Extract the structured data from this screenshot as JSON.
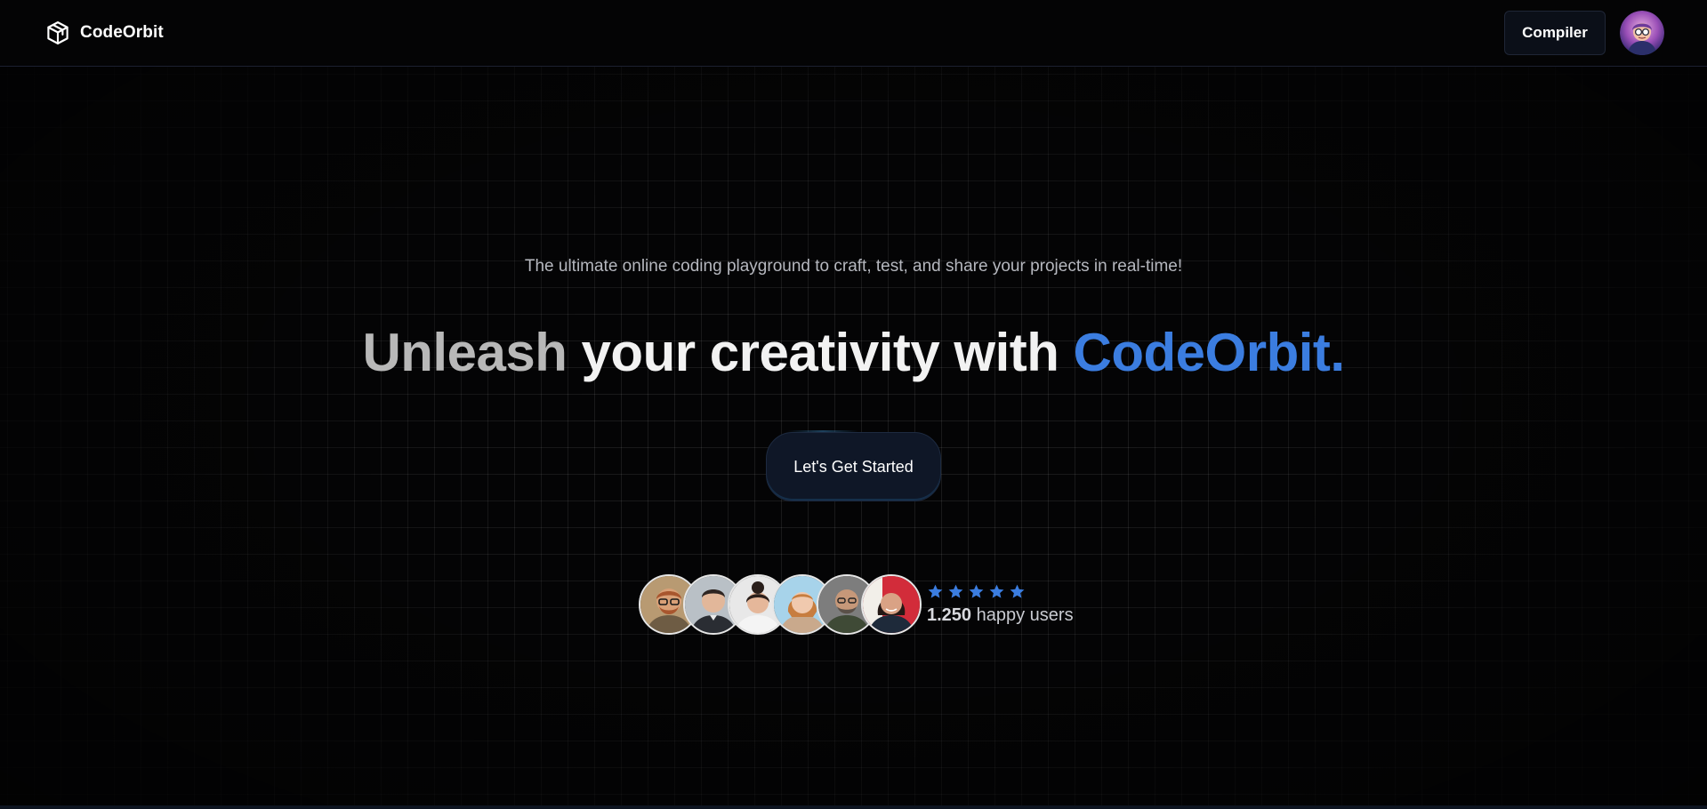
{
  "header": {
    "brand_name": "CodeOrbit",
    "brand_icon": "cube-icon",
    "compiler_label": "Compiler",
    "profile_icon": "user-avatar"
  },
  "hero": {
    "subtitle": "The ultimate online coding playground to craft, test, and share your projects in real-time!",
    "headline_part1": "Unleash",
    "headline_part2": "your creativity with",
    "headline_brand": "CodeOrbit.",
    "cta_label": "Let's Get Started"
  },
  "social_proof": {
    "avatars": [
      "user-face-1",
      "user-face-2",
      "user-face-3",
      "user-face-4",
      "user-face-5",
      "user-face-6"
    ],
    "rating_stars": 5,
    "user_count": "1.250",
    "user_suffix": "happy users"
  },
  "colors": {
    "background": "#040405",
    "accent_blue": "#3b7de0",
    "button_bg": "#0f1727",
    "star": "#3b7de0"
  }
}
